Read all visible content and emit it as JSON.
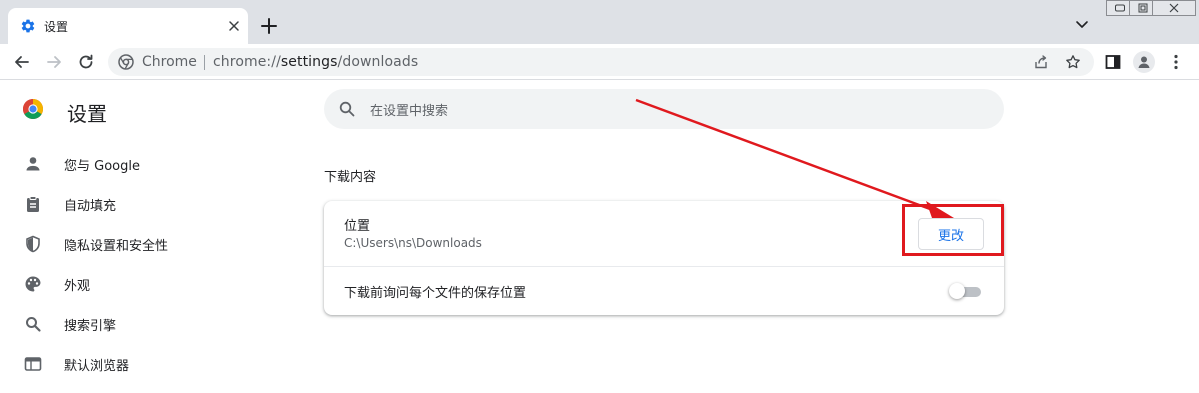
{
  "browser": {
    "tab": {
      "title": "设置",
      "favicon": "gear-icon"
    },
    "address": {
      "chip": "Chrome",
      "url_scheme": "chrome://",
      "url_host": "settings",
      "url_path": "/downloads"
    }
  },
  "settings": {
    "title": "设置",
    "search_placeholder": "在设置中搜索",
    "nav": [
      {
        "label": "您与 Google",
        "icon": "person-icon"
      },
      {
        "label": "自动填充",
        "icon": "clipboard-icon"
      },
      {
        "label": "隐私设置和安全性",
        "icon": "shield-icon"
      },
      {
        "label": "外观",
        "icon": "palette-icon"
      },
      {
        "label": "搜索引擎",
        "icon": "search-icon"
      },
      {
        "label": "默认浏览器",
        "icon": "browser-window-icon"
      }
    ],
    "section_title": "下载内容",
    "location": {
      "label": "位置",
      "path": "C:\\Users\\ns\\Downloads",
      "change_label": "更改"
    },
    "ask_where_to_save": {
      "label": "下载前询问每个文件的保存位置",
      "enabled": false
    }
  },
  "colors": {
    "accent": "#1a73e8",
    "annotation": "#e0191e",
    "tabstrip": "#dee1e6"
  }
}
